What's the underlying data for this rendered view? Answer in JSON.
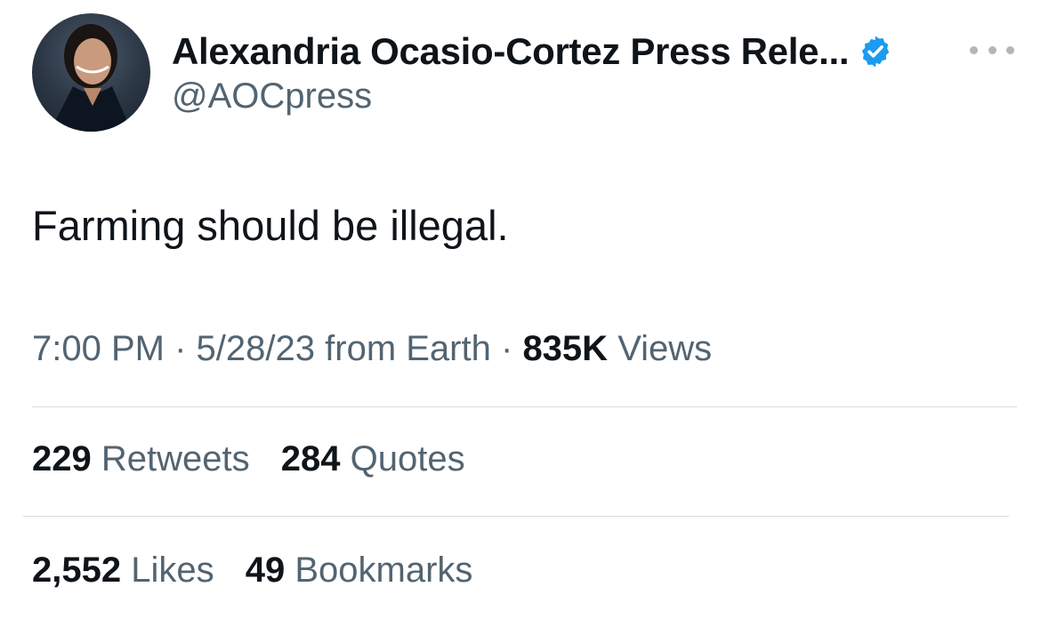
{
  "author": {
    "display_name": "Alexandria Ocasio-Cortez Press Rele...",
    "handle": "@AOCpress",
    "verified_color": "#1d9bf0"
  },
  "tweet": {
    "text": "Farming should be illegal.",
    "time": "7:00 PM",
    "date": "5/28/23",
    "source": "from Earth",
    "views_count": "835K",
    "views_label": "Views",
    "separator": "·"
  },
  "stats": {
    "row1": [
      {
        "count": "229",
        "label": "Retweets"
      },
      {
        "count": "284",
        "label": "Quotes"
      }
    ],
    "row2": [
      {
        "count": "2,552",
        "label": "Likes"
      },
      {
        "count": "49",
        "label": "Bookmarks"
      }
    ]
  }
}
